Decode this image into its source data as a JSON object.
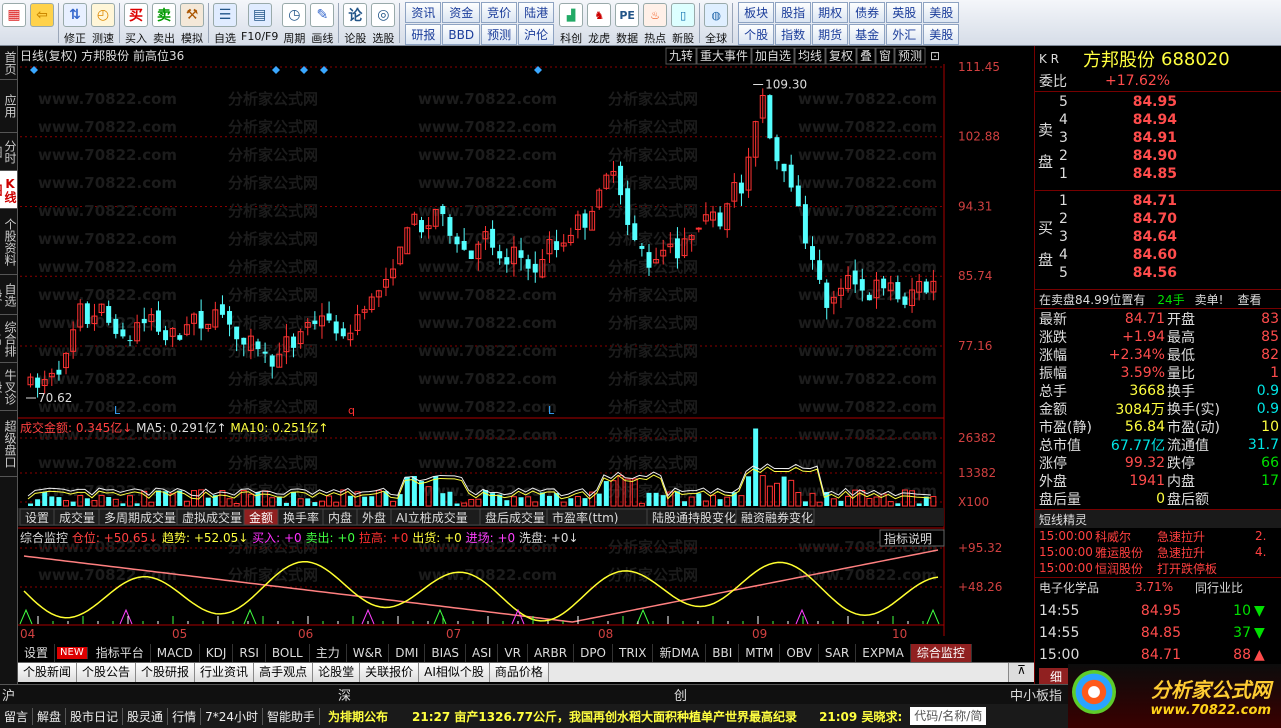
{
  "toolbar": {
    "left_buttons": [
      {
        "label": "",
        "icon": "grid-icon"
      },
      {
        "label": "",
        "icon": "back-arrow-icon"
      },
      {
        "label": "修正",
        "icon": "up-down-icon"
      },
      {
        "label": "测速",
        "icon": "speed-icon"
      },
      {
        "label": "买入",
        "icon": "buy-icon"
      },
      {
        "label": "卖出",
        "icon": "sell-icon"
      },
      {
        "label": "模拟",
        "icon": "hammer-icon"
      },
      {
        "label": "自选",
        "icon": "star-list-icon"
      },
      {
        "label": "F10/F9",
        "icon": "f10-icon"
      },
      {
        "label": "周期",
        "icon": "clock-icon"
      },
      {
        "label": "画线",
        "icon": "pencil-icon"
      },
      {
        "label": "论股",
        "icon": "chat-icon"
      },
      {
        "label": "选股",
        "icon": "select-icon"
      }
    ],
    "grid1": [
      "资讯",
      "研报",
      "资金",
      "BBD",
      "竞价",
      "预测",
      "陆港",
      "沪伦"
    ],
    "mid_buttons": [
      {
        "label": "科创",
        "icon": "chart-icon"
      },
      {
        "label": "龙虎",
        "icon": "dragon-icon"
      },
      {
        "label": "数据",
        "icon": "pe-icon"
      },
      {
        "label": "热点",
        "icon": "hot-icon"
      },
      {
        "label": "新股",
        "icon": "phone-icon"
      },
      {
        "label": "全球",
        "icon": "globe-icon"
      }
    ],
    "grid2": [
      "板块",
      "个股",
      "股指",
      "指数",
      "期权",
      "期货",
      "债券",
      "基金",
      "英股",
      "外汇",
      "美股",
      "美股"
    ]
  },
  "left_tabs": [
    "首页",
    "应用",
    "分时图",
    "K线图",
    "个股资料",
    "自选股",
    "综合排名",
    "牛叉诊股",
    "超级盘口"
  ],
  "chart": {
    "title": "日线(复权)",
    "stock_name": "方邦股份",
    "indicator": "前高位36",
    "right_buttons": [
      "九转",
      "重大事件",
      "加自选",
      "均线",
      "复权",
      "叠",
      "窗",
      "预测"
    ],
    "price_labels": [
      "111.45",
      "102.88",
      "94.31",
      "85.74",
      "77.16"
    ],
    "max_label": "109.30",
    "min_label": "70.62",
    "markers": [
      "L",
      "q",
      "L"
    ],
    "volume_header": {
      "label": "成交金额: 0.345亿",
      "ma5": "MA5: 0.291亿",
      "ma10": "MA10: 0.251亿"
    },
    "volume_labels": [
      "26382",
      "13382",
      "X100"
    ],
    "vol_tabs": [
      "设置",
      "成交量",
      "多周期成交量",
      "虚拟成交量",
      "金额",
      "换手率",
      "内盘",
      "外盘",
      "AI立桩成交量",
      "盘后成交量",
      "市盈率(ttm)",
      "陆股通持股变化",
      "融资融券变化"
    ],
    "vol_active": "金额",
    "monitor_header": {
      "name": "综合监控",
      "pos": "仓位: +50.65",
      "trend": "趋势: +52.05",
      "buy": "买入: +0",
      "sell": "卖出: +0",
      "pull": "拉高: +0",
      "out": "出货: +0",
      "enter": "进场: +0",
      "wash": "洗盘: +0"
    },
    "monitor_btn": "指标说明",
    "monitor_labels": [
      "+95.32",
      "+48.26"
    ],
    "months": [
      "04",
      "05",
      "06",
      "07",
      "08",
      "09",
      "10"
    ],
    "watermark": "www.70822.com"
  },
  "indicator_tabs": [
    "设置",
    "NEW",
    "指标平台",
    "MACD",
    "KDJ",
    "RSI",
    "BOLL",
    "主力",
    "W&R",
    "DMI",
    "BIAS",
    "ASI",
    "VR",
    "ARBR",
    "DPO",
    "TRIX",
    "新DMA",
    "BBI",
    "MTM",
    "OBV",
    "SAR",
    "EXPMA",
    "综合监控"
  ],
  "indicator_active": "综合监控",
  "news_tabs": [
    "个股新闻",
    "个股公告",
    "个股研报",
    "行业资讯",
    "高手观点",
    "论股堂",
    "关联报价",
    "AI相似个股",
    "商品价格"
  ],
  "right_panel": {
    "kr": "K R",
    "name": "方邦股份",
    "code": "688020",
    "weibi_label": "委比",
    "weibi": "+17.62%",
    "sell_label": "卖盘",
    "buy_label": "买盘",
    "sells": [
      [
        "5",
        "84.95"
      ],
      [
        "4",
        "84.94"
      ],
      [
        "3",
        "84.91"
      ],
      [
        "2",
        "84.90"
      ],
      [
        "1",
        "84.85"
      ]
    ],
    "buys": [
      [
        "1",
        "84.71"
      ],
      [
        "2",
        "84.70"
      ],
      [
        "3",
        "84.64"
      ],
      [
        "4",
        "84.60"
      ],
      [
        "5",
        "84.56"
      ]
    ],
    "notice": "在卖盘84.99位置有",
    "notice_qty": "24手",
    "notice_act": "卖单!",
    "notice_link": "查看",
    "stats": [
      [
        "最新",
        "84.71",
        "开盘",
        "83"
      ],
      [
        "涨跌",
        "+1.94",
        "最高",
        "85"
      ],
      [
        "涨幅",
        "+2.34%",
        "最低",
        "82"
      ],
      [
        "振幅",
        "3.59%",
        "量比",
        "1"
      ],
      [
        "总手",
        "3668",
        "换手",
        "0.9"
      ],
      [
        "金额",
        "3084万",
        "换手(实)",
        "0.9"
      ],
      [
        "市盈(静)",
        "56.84",
        "市盈(动)",
        "10"
      ],
      [
        "总市值",
        "67.77亿",
        "流通值",
        "31.7"
      ],
      [
        "涨停",
        "99.32",
        "跌停",
        "66"
      ],
      [
        "外盘",
        "1941",
        "内盘",
        "17"
      ],
      [
        "盘后量",
        "0",
        "盘后额",
        ""
      ]
    ],
    "short_title": "短线精灵",
    "short_items": [
      [
        "15:00:00",
        "科威尔",
        "急速拉升",
        "2."
      ],
      [
        "15:00:00",
        "雅运股份",
        "急速拉升",
        "4."
      ],
      [
        "15:00:00",
        "恒润股份",
        "打开跌停板",
        ""
      ]
    ],
    "sector": "电子化学品",
    "sector_pct": "3.71%",
    "sector_rank": "同行业比",
    "ticks": [
      [
        "14:55",
        "84.95",
        "10"
      ],
      [
        "14:55",
        "84.85",
        "37"
      ],
      [
        "15:00",
        "84.71",
        "88"
      ]
    ],
    "tick_tab": "细"
  },
  "status": {
    "hu": "沪",
    "shen": "深",
    "chuang": "创",
    "small": "中小板指"
  },
  "ticker": {
    "items": [
      "留言",
      "解盘",
      "股市日记",
      "股灵通",
      "行情",
      "7*24小时",
      "智能助手"
    ],
    "news1": "为排期公布",
    "news2": "21:27 亩产1326.77公斤，我国再创水稻大面积种植单产世界最高纪录",
    "news3": "21:09 吴晓求:",
    "search": "代码/名称/简"
  },
  "brand": "分析家公式网",
  "brand_url": "www.70822.com"
}
